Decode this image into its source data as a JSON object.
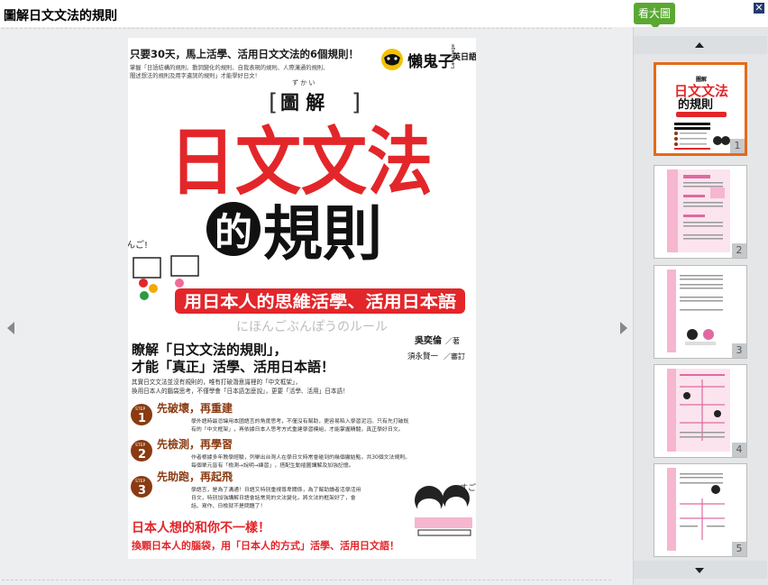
{
  "window": {
    "title": "圖解日文文法的規則",
    "close_label": "✕"
  },
  "enlarge_badge": "看大圖",
  "cover": {
    "tagline": "只要30天，馬上活學、活用日文文法的6個規則！",
    "subtagline_1": "掌握「日語結構的規則、動詞變化的規則、自我表現的規則、人際溝通的規則、",
    "subtagline_2": "闡述想法的規則及用字遣詞的規則」才能學好日文！",
    "publisher_brand": "懶鬼子",
    "publisher_sub": "英日語",
    "publisher_en": "Language",
    "kanji_ruby": "ず か い",
    "series_label": "圖 解",
    "main_title_1": "日文文法",
    "title_circle_char": "的",
    "main_title_2": "規則",
    "nihongo_handwritten": "にほんご!",
    "red_banner": "用日本人的思維活學、活用日本語",
    "japanese_subtitle": "にほんごぶんぽうのルール",
    "headline_1": "瞭解「日文文法的規則」，",
    "headline_2": "才能「真正」活學、活用日本語！",
    "author": "吳奕倫",
    "author_role": "／著",
    "reviewer": "須永賢一",
    "reviewer_role": "／審訂",
    "intro_1": "其實日文文法並沒有規則的，唯有打破潛意識裡的「中文框架」，",
    "intro_2": "換用日本人的腦袋思考，不僅學會「日本語怎麼說」，更要「活學、活用」日本語！",
    "steps": [
      {
        "label": "STEP",
        "num": "1",
        "title": "先破壞，再重建",
        "body_1": "學外語時最忌諱用本國語言的角度思考，不僅沒有幫助，更容易陷入學習泥沼。只有先打破既",
        "body_2": "有的「中文框架」，再依據日本人思考方式重建學習模組，才能掌握精髓，真正學好日文。"
      },
      {
        "label": "STEP",
        "num": "2",
        "title": "先檢測，再學習",
        "body_1": "作者根據多年教學經驗，列舉出台灣人在學日文時常會碰到的幾個繳結點，共30個文法規則。",
        "body_2": "每個單元皆有「檢測→說明→練習」，搭配生動插圖講解及加強記憶。"
      },
      {
        "label": "STEP",
        "num": "3",
        "title": "先助跑，再起飛",
        "body_1": "學語言，是為了溝通！日語又特別重視尊卑關係，為了幫助讀者活學活用",
        "body_2": "日文，特別加強講解日語會話常見的文法變化，將文法的框架好了，會",
        "body_3": "話、寫作、日檢就不是問題了！"
      }
    ],
    "sugoi_handwritten": "すごい!",
    "closing_1": "日本人想的和你不一樣！",
    "closing_2": "換顆日本人的腦袋，用「日本人的方式」活學、活用日文語！"
  },
  "thumbnails": [
    {
      "num": "1",
      "selected": true
    },
    {
      "num": "2",
      "selected": false
    },
    {
      "num": "3",
      "selected": false
    },
    {
      "num": "4",
      "selected": false
    },
    {
      "num": "5",
      "selected": false
    }
  ],
  "thumb_title_mini_1": "圖解",
  "thumb_title_mini_2": "日文文法",
  "thumb_title_mini_3": "的規則",
  "colors": {
    "red": "#e3262a",
    "dark": "#1a1a1a",
    "step_brown": "#8a3b12",
    "pink": "#f6b6cf",
    "thumb_border": "#e56a1a",
    "badge_green": "#5aa832"
  }
}
